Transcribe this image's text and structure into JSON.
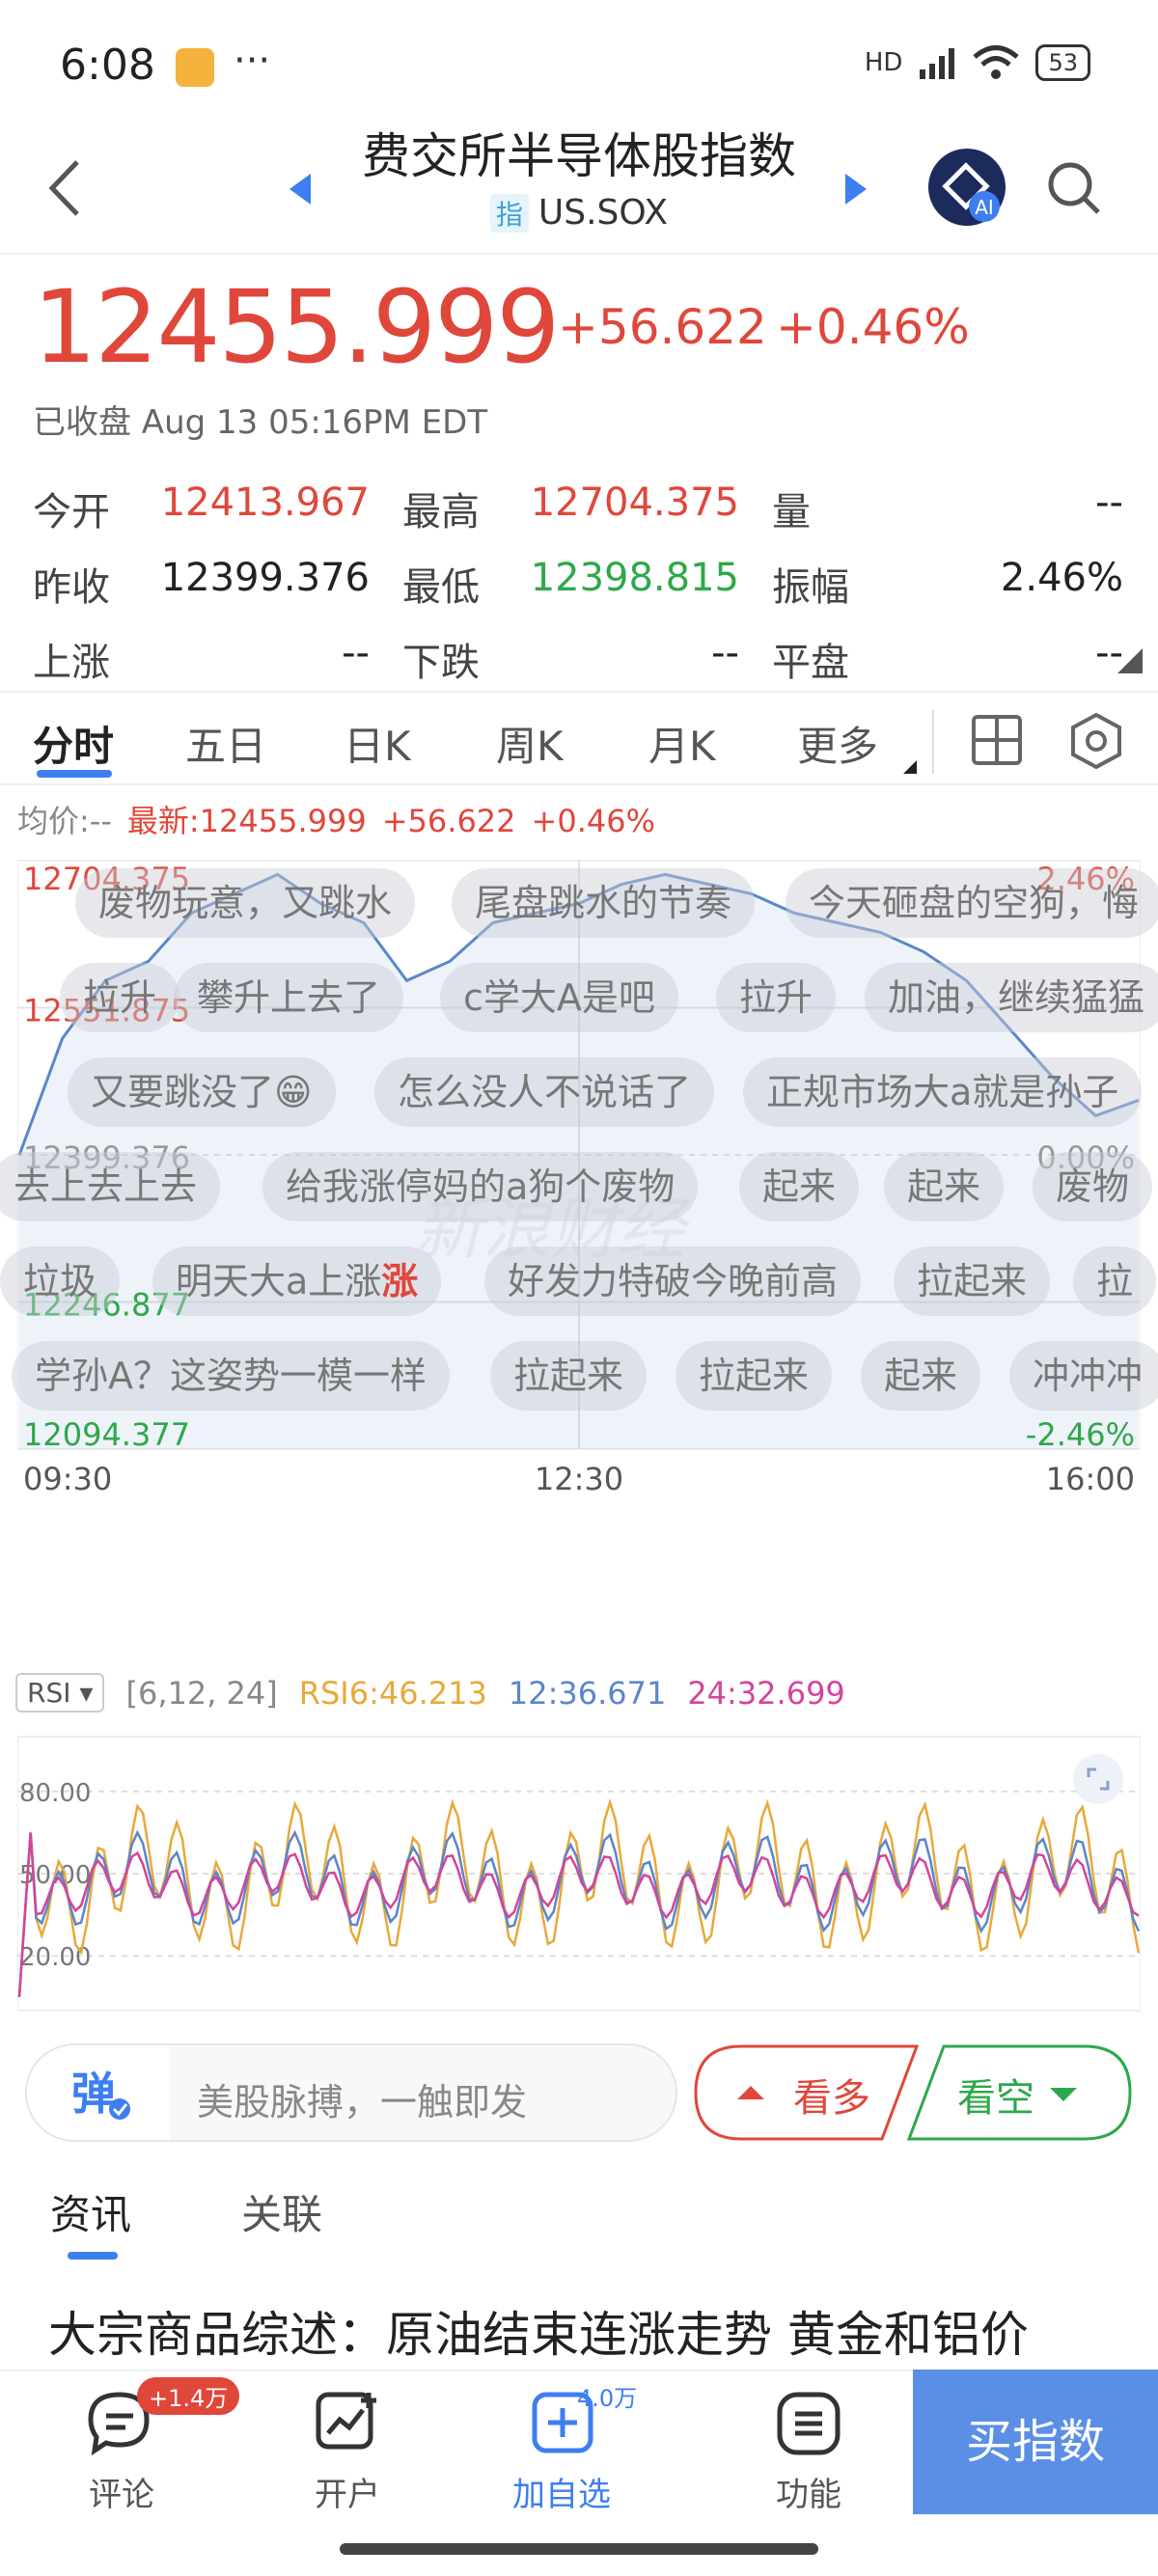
{
  "status_bar": {
    "time": "6:08",
    "dots": "···",
    "network": "HD",
    "battery": "53"
  },
  "header": {
    "title": "费交所半导体股指数",
    "tag": "指",
    "symbol": "US.SOX"
  },
  "quote": {
    "price": "12455.999",
    "change": "+56.622",
    "change_pct": "+0.46%",
    "status": "已收盘 Aug 13 05:16PM EDT"
  },
  "stats": [
    [
      {
        "label": "今开",
        "value": "12413.967",
        "tone": "red"
      },
      {
        "label": "最高",
        "value": "12704.375",
        "tone": "red"
      },
      {
        "label": "量",
        "value": "--",
        "tone": "dark"
      }
    ],
    [
      {
        "label": "昨收",
        "value": "12399.376",
        "tone": "dark"
      },
      {
        "label": "最低",
        "value": "12398.815",
        "tone": "green"
      },
      {
        "label": "振幅",
        "value": "2.46%",
        "tone": "dark"
      }
    ],
    [
      {
        "label": "上涨",
        "value": "--",
        "tone": "dark"
      },
      {
        "label": "下跌",
        "value": "--",
        "tone": "dark"
      },
      {
        "label": "平盘",
        "value": "--",
        "tone": "dark"
      }
    ]
  ],
  "tabs": [
    "分时",
    "五日",
    "日K",
    "周K",
    "月K",
    "更多"
  ],
  "latest": {
    "avg": "均价:--",
    "latest": "最新:12455.999",
    "change": "+56.622",
    "pct": "+0.46%"
  },
  "chart_data": {
    "type": "line",
    "title": "",
    "x_ticks": [
      "09:30",
      "12:30",
      "16:00"
    ],
    "y_ticks_left": [
      "12704.375",
      "12551.875",
      "12399.376",
      "12246.877",
      "12094.377"
    ],
    "y_ticks_right": [
      "2.46%",
      "",
      "0.00%",
      "",
      "-2.46%"
    ],
    "ylim": [
      12094.377,
      12704.375
    ],
    "prev_close": 12399.376,
    "x": [
      "09:30",
      "09:45",
      "10:00",
      "10:15",
      "10:30",
      "10:45",
      "11:00",
      "11:15",
      "11:30",
      "11:45",
      "12:00",
      "12:15",
      "12:30",
      "12:45",
      "13:00",
      "13:15",
      "13:30",
      "13:45",
      "14:00",
      "14:15",
      "14:30",
      "14:45",
      "15:00",
      "15:15",
      "15:30",
      "15:45",
      "16:00"
    ],
    "values": [
      12399,
      12520,
      12580,
      12600,
      12650,
      12670,
      12690,
      12660,
      12640,
      12580,
      12600,
      12640,
      12650,
      12660,
      12680,
      12690,
      12680,
      12670,
      12650,
      12640,
      12630,
      12610,
      12580,
      12530,
      12480,
      12440,
      12456
    ]
  },
  "danmu": [
    {
      "text": "废物玩意，又跳水"
    },
    {
      "text": "尾盘跳水的节奏"
    },
    {
      "text": "今天砸盘的空狗，悔"
    },
    {
      "text": "拉升"
    },
    {
      "text": "攀升上去了"
    },
    {
      "text": "c学大A是吧"
    },
    {
      "text": "拉升"
    },
    {
      "text": "加油，继续猛猛"
    },
    {
      "text": "又要跳没了😁"
    },
    {
      "text": "怎么没人不说话了"
    },
    {
      "text": "正规市场大a就是孙子"
    },
    {
      "text": "去上去上去"
    },
    {
      "text": "给我涨停妈的a狗个废物"
    },
    {
      "text": "起来"
    },
    {
      "text": "起来"
    },
    {
      "text": "废物"
    },
    {
      "text": "垃圾"
    },
    {
      "text": "明天大a上涨"
    },
    {
      "text": "涨"
    },
    {
      "text": "好发力特破今晚前高"
    },
    {
      "text": "拉起来"
    },
    {
      "text": "拉"
    },
    {
      "text": "学孙A？这姿势一模一样"
    },
    {
      "text": "拉起来"
    },
    {
      "text": "拉起来"
    },
    {
      "text": "起来"
    },
    {
      "text": "冲冲冲"
    }
  ],
  "watermark": "新浪财经",
  "rsi": {
    "selector": "RSI",
    "params": "[6,12, 24]",
    "rsi6": "RSI6:46.213",
    "rsi12": "12:36.671",
    "rsi24": "24:32.699",
    "y_ticks": [
      "80.00",
      "50.00",
      "20.00"
    ],
    "colors": {
      "rsi6": "#e8a93a",
      "rsi12": "#5b86c9",
      "rsi24": "#d4449a"
    }
  },
  "comment_bar": {
    "placeholder": "美股脉搏，一触即发",
    "bull": "看多",
    "bear": "看空"
  },
  "news_tabs": [
    "资讯",
    "关联"
  ],
  "news_headline": "大宗商品综述：原油结束连涨走势 黄金和铝价",
  "bottom_nav": {
    "items": [
      {
        "label": "评论",
        "badge": "+1.4万"
      },
      {
        "label": "开户",
        "badge": ""
      },
      {
        "label": "加自选",
        "badge": "4.0万"
      },
      {
        "label": "功能",
        "badge": ""
      }
    ],
    "buy": "买指数"
  },
  "colors": {
    "up": "#e0473b",
    "down": "#2ea84a",
    "accent": "#3d7ef0",
    "line": "#5b86c9"
  }
}
